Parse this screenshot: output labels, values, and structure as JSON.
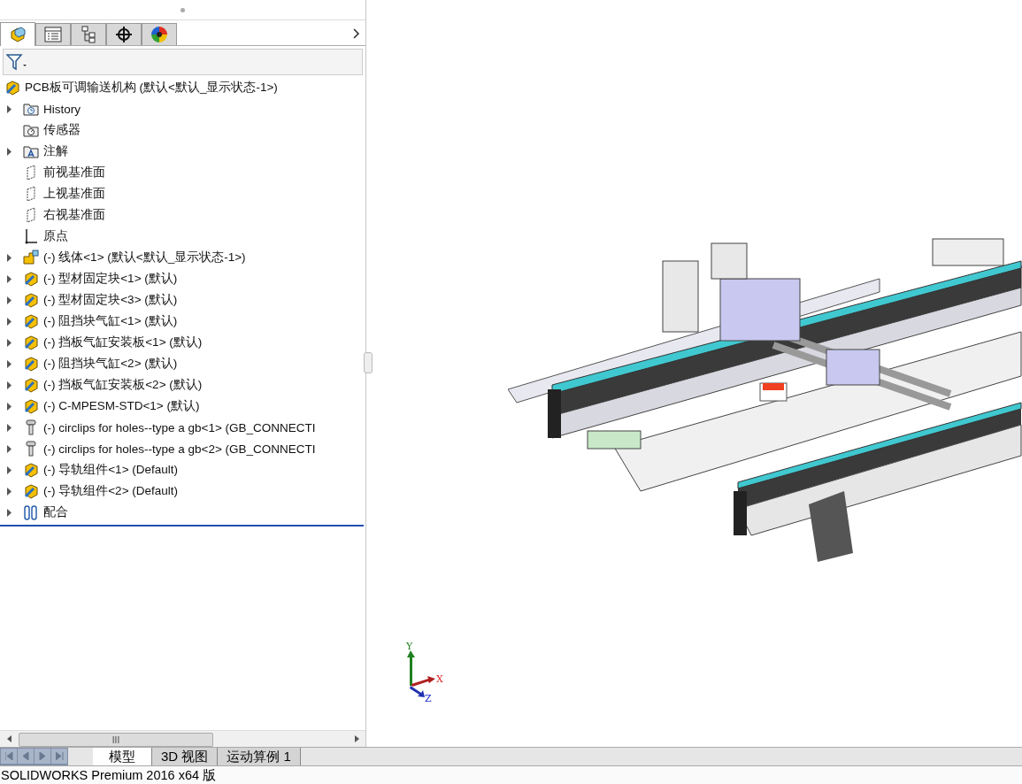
{
  "panel_tabs": [
    {
      "kind": "feature-tree",
      "selected": true
    },
    {
      "kind": "property",
      "selected": false
    },
    {
      "kind": "config",
      "selected": false
    },
    {
      "kind": "dimxpert",
      "selected": false
    },
    {
      "kind": "display",
      "selected": false
    }
  ],
  "tree": {
    "root": {
      "label": "PCB板可调输送机构  (默认<默认_显示状态-1>)"
    },
    "items": [
      {
        "label": "History",
        "kind": "history",
        "expandable": true
      },
      {
        "label": "传感器",
        "kind": "sensor",
        "expandable": false
      },
      {
        "label": "注解",
        "kind": "annotation",
        "expandable": true
      },
      {
        "label": "前视基准面",
        "kind": "plane",
        "expandable": false
      },
      {
        "label": "上视基准面",
        "kind": "plane",
        "expandable": false
      },
      {
        "label": "右视基准面",
        "kind": "plane",
        "expandable": false
      },
      {
        "label": "原点",
        "kind": "origin",
        "expandable": false
      },
      {
        "label": "(-) 线体<1> (默认<默认_显示状态-1>)",
        "kind": "subassembly",
        "expandable": true
      },
      {
        "label": "(-) 型材固定块<1> (默认)",
        "kind": "part",
        "expandable": true
      },
      {
        "label": "(-) 型材固定块<3> (默认)",
        "kind": "part",
        "expandable": true
      },
      {
        "label": "(-) 阻挡块气缸<1> (默认)",
        "kind": "part",
        "expandable": true
      },
      {
        "label": "(-) 挡板气缸安装板<1> (默认)",
        "kind": "part",
        "expandable": true
      },
      {
        "label": "(-) 阻挡块气缸<2> (默认)",
        "kind": "part",
        "expandable": true
      },
      {
        "label": "(-) 挡板气缸安装板<2> (默认)",
        "kind": "part",
        "expandable": true
      },
      {
        "label": "(-) C-MPESM-STD<1> (默认)",
        "kind": "part",
        "expandable": true
      },
      {
        "label": "(-) circlips for holes--type a gb<1> (GB_CONNECTI",
        "kind": "fastener",
        "expandable": true
      },
      {
        "label": "(-) circlips for holes--type a gb<2> (GB_CONNECTI",
        "kind": "fastener",
        "expandable": true
      },
      {
        "label": "(-) 导轨组件<1> (Default)",
        "kind": "part",
        "expandable": true
      },
      {
        "label": "(-) 导轨组件<2> (Default)",
        "kind": "part",
        "expandable": true
      },
      {
        "label": "配合",
        "kind": "mates",
        "expandable": true
      }
    ]
  },
  "scrollbar_thumb": "III",
  "bottom_tabs": [
    {
      "label": "模型",
      "selected": true
    },
    {
      "label": "3D 视图",
      "selected": false
    },
    {
      "label": "运动算例 1",
      "selected": false
    }
  ],
  "triad": {
    "x": "X",
    "y": "Y",
    "z": "Z"
  },
  "status_bar": "SOLIDWORKS Premium 2016 x64 版"
}
